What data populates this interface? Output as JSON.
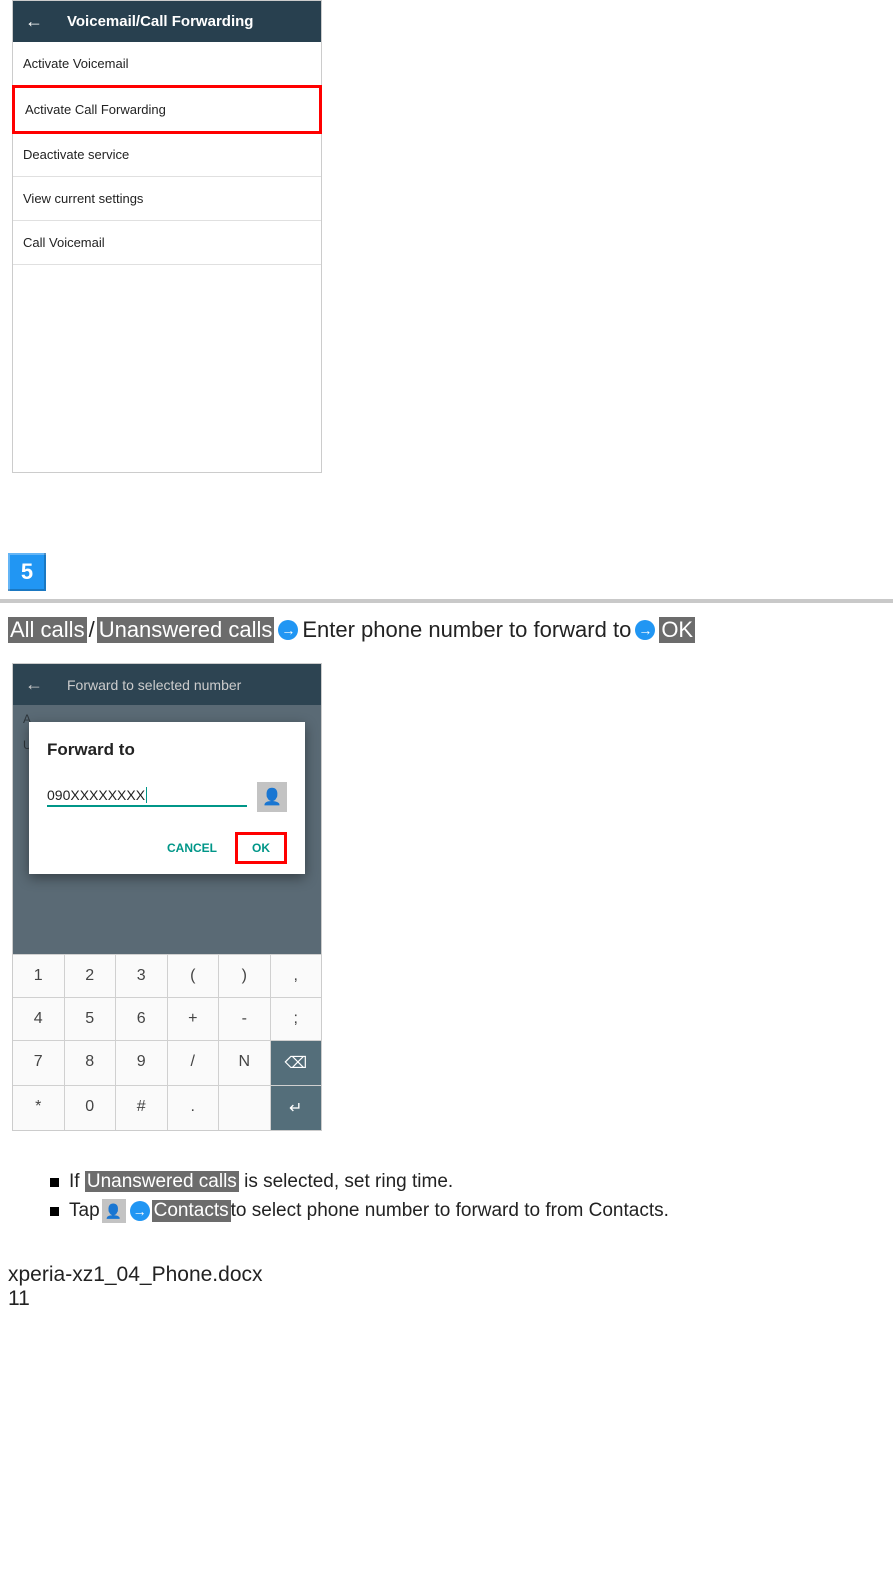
{
  "screen1": {
    "title": "Voicemail/Call Forwarding",
    "items": [
      "Activate Voicemail",
      "Activate Call Forwarding",
      "Deactivate service",
      "View current settings",
      "Call Voicemail"
    ]
  },
  "step": {
    "number": "5"
  },
  "instruction": {
    "part1": "All calls",
    "slash": "/",
    "part2": "Unanswered calls",
    "middle": "Enter phone number to forward to",
    "end": "OK"
  },
  "screen2": {
    "header": "Forward to selected number",
    "bg_hint1": "A",
    "bg_hint2": "U",
    "dialog_title": "Forward to",
    "phone_value": "090XXXXXXXX",
    "cancel": "CANCEL",
    "ok": "OK",
    "keypad": [
      [
        "1",
        "2",
        "3",
        "(",
        ")",
        ","
      ],
      [
        "4",
        "5",
        "6",
        "+",
        "-",
        ";"
      ],
      [
        "7",
        "8",
        "9",
        "/",
        "N",
        "⌫"
      ],
      [
        "*",
        "0",
        "#",
        ".",
        "",
        "↵"
      ]
    ]
  },
  "notes": {
    "n1_a": "If ",
    "n1_hl": "Unanswered calls",
    "n1_b": " is selected, set ring time.",
    "n2_a": "Tap  ",
    "n2_hl": "Contacts",
    "n2_b": " to select phone number to forward to from Contacts."
  },
  "footer": {
    "filename": "xperia-xz1_04_Phone.docx",
    "page": "11"
  }
}
